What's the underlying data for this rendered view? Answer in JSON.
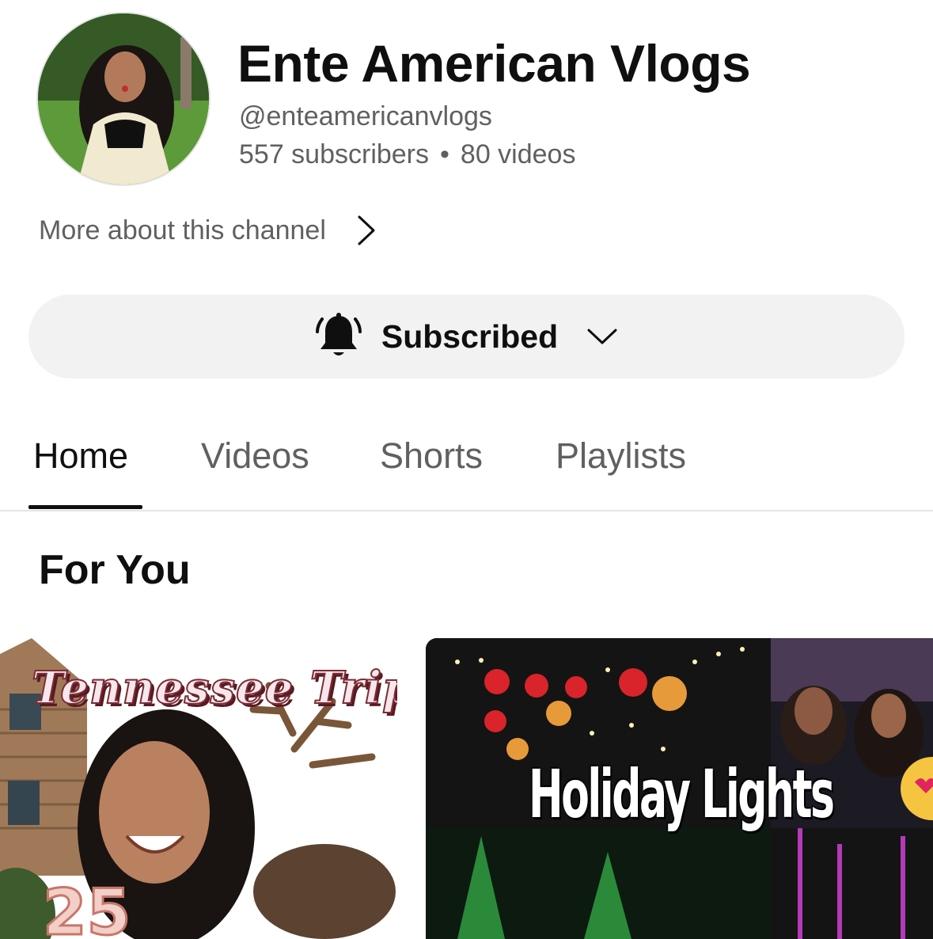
{
  "channel": {
    "name": "Ente American Vlogs",
    "handle": "@enteamericanvlogs",
    "subscribers": "557 subscribers",
    "separator": "•",
    "videos": "80 videos",
    "more_about": "More about this channel"
  },
  "subscribe": {
    "label": "Subscribed",
    "bell_icon": "bell-ringing-icon",
    "chevron_icon": "chevron-down-icon"
  },
  "tabs": [
    {
      "label": "Home",
      "active": true
    },
    {
      "label": "Videos",
      "active": false
    },
    {
      "label": "Shorts",
      "active": false
    },
    {
      "label": "Playlists",
      "active": false
    }
  ],
  "section": {
    "title": "For You"
  },
  "videos": [
    {
      "thumbnail_text": "Tennessee Trip",
      "thumbnail_number": "25"
    },
    {
      "thumbnail_text": "Holiday Lights"
    }
  ],
  "colors": {
    "primary_text": "#0f0f0f",
    "secondary_text": "#606060",
    "button_bg": "#f2f2f2",
    "divider": "#e5e5e5"
  }
}
